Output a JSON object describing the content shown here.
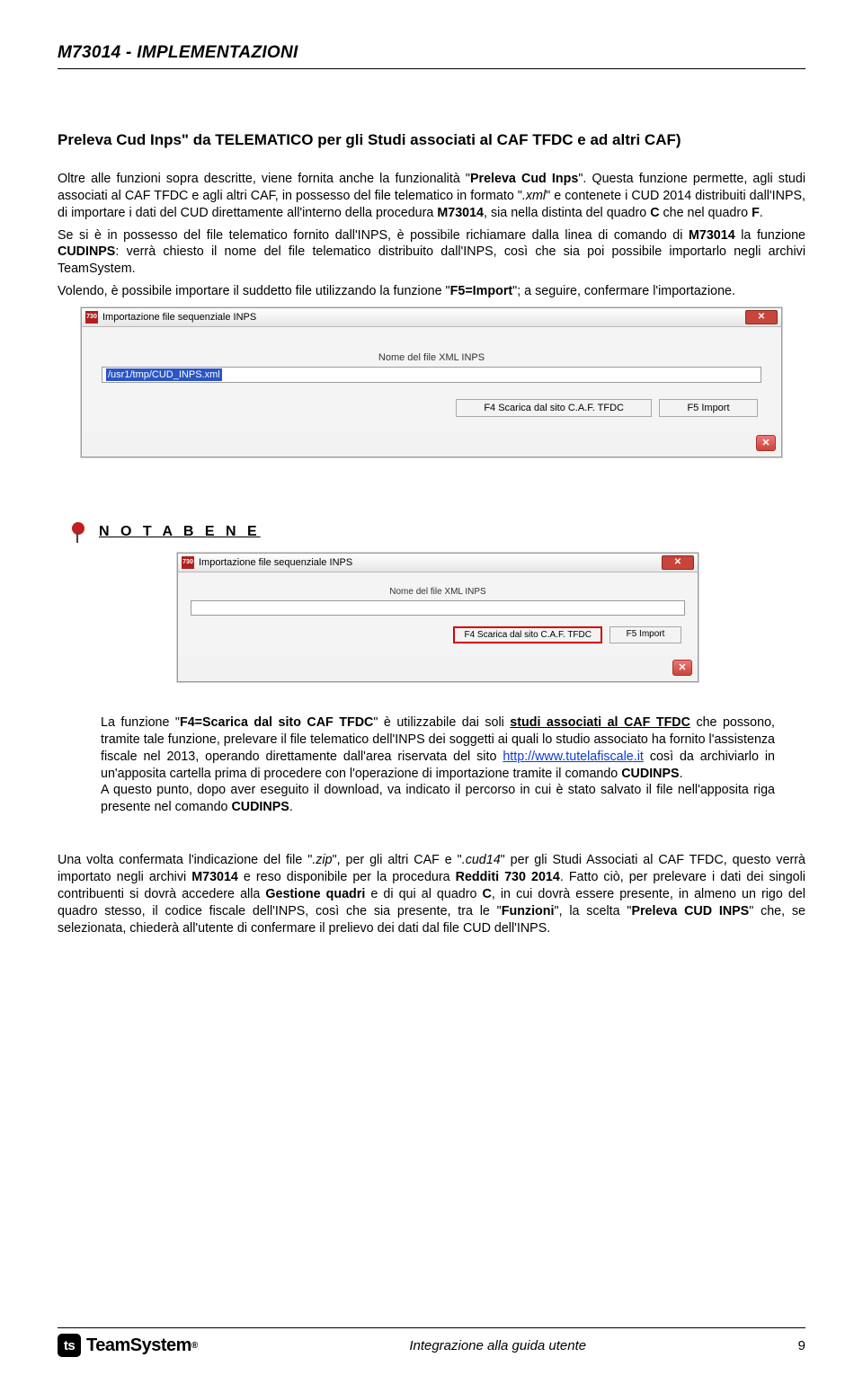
{
  "header": {
    "title": "M73014 - IMPLEMENTAZIONI"
  },
  "section": {
    "heading": "Preleva Cud Inps\" da TELEMATICO per gli Studi associati al CAF TFDC e ad altri CAF)",
    "p1_a": "Oltre alle funzioni sopra descritte, viene fornita anche la funzionalità \"",
    "p1_b": "Preleva Cud Inps",
    "p1_c": "\". Questa funzione permette, agli studi associati al CAF TFDC e agli altri CAF, in possesso del file telematico in formato \"",
    "p1_d": ".xml",
    "p1_e": "\" e contenete i CUD 2014 distribuiti dall'INPS, di importare i dati del CUD direttamente all'interno della procedura ",
    "p1_f": "M73014",
    "p1_g": ", sia nella distinta del quadro ",
    "p1_h": "C",
    "p1_i": " che nel quadro ",
    "p1_j": "F",
    "p1_k": ".",
    "p2_a": "Se si è in possesso del file telematico fornito dall'INPS, è possibile richiamare dalla linea di comando di ",
    "p2_b": "M73014",
    "p2_c": " la funzione ",
    "p2_d": "CUDINPS",
    "p2_e": ": verrà chiesto il nome del file telematico distribuito dall'INPS, così che sia poi possibile importarlo negli archivi TeamSystem.",
    "p3_a": "Volendo, è possibile importare il suddetto file utilizzando la funzione \"",
    "p3_b": "F5=Import",
    "p3_c": "\"; a seguire, confermare l'importazione."
  },
  "win1": {
    "title": "Importazione file sequenziale INPS",
    "field_label": "Nome del file XML INPS",
    "path": "/usr1/tmp/CUD_INPS.xml",
    "btn_scarica": "F4 Scarica dal sito C.A.F. TFDC",
    "btn_import": "F5 Import"
  },
  "nota": {
    "label": "N O T A   B E N E",
    "win": {
      "title": "Importazione file sequenziale INPS",
      "field_label": "Nome del file XML INPS",
      "btn_scarica": "F4 Scarica dal sito C.A.F. TFDC",
      "btn_import": "F5 Import"
    },
    "t1_a": "La funzione \"",
    "t1_b": "F4=Scarica dal sito CAF TFDC",
    "t1_c": "\" è utilizzabile dai soli ",
    "t1_d": "studi associati al CAF TFDC",
    "t1_e": " che possono, tramite tale funzione, prelevare il file telematico dell'INPS dei soggetti ai quali lo studio associato ha fornito l'assistenza fiscale nel 2013, operando direttamente dall'area riservata del sito ",
    "t1_link": "http://www.tutelafiscale.it",
    "t1_f": " così da archiviarlo in un'apposita cartella prima di procedere con l'operazione di importazione tramite il comando ",
    "t1_g": "CUDINPS",
    "t1_h": ".",
    "t2_a": "A questo punto, dopo aver eseguito il download, va indicato il percorso in cui è stato salvato il file nell'apposita riga presente nel comando ",
    "t2_b": "CUDINPS",
    "t2_c": "."
  },
  "final": {
    "p1_a": "Una volta confermata l'indicazione del file \"",
    "p1_b": ".zip",
    "p1_c": "\", per gli altri CAF e \"",
    "p1_d": ".cud14",
    "p1_e": "\" per gli Studi Associati al CAF TFDC, questo verrà importato negli archivi ",
    "p1_f": "M73014",
    "p1_g": " e reso disponibile per la procedura ",
    "p1_h": "Redditi 730 2014",
    "p1_i": ". Fatto ciò, per prelevare i dati dei singoli contribuenti si dovrà accedere alla ",
    "p1_j": "Gestione quadri",
    "p1_k": " e di qui al quadro ",
    "p1_l": "C",
    "p1_m": ", in cui dovrà essere presente, in almeno un rigo del quadro stesso, il codice fiscale dell'INPS, così che sia presente, tra le \"",
    "p1_n": "Funzioni",
    "p1_o": "\", la scelta \"",
    "p1_p": "Preleva CUD INPS",
    "p1_q": "\" che, se selezionata, chiederà all'utente di confermare il prelievo dei dati dal file CUD dell'INPS."
  },
  "footer": {
    "logo": "TeamSystem",
    "center": "Integrazione alla guida utente",
    "page": "9"
  }
}
